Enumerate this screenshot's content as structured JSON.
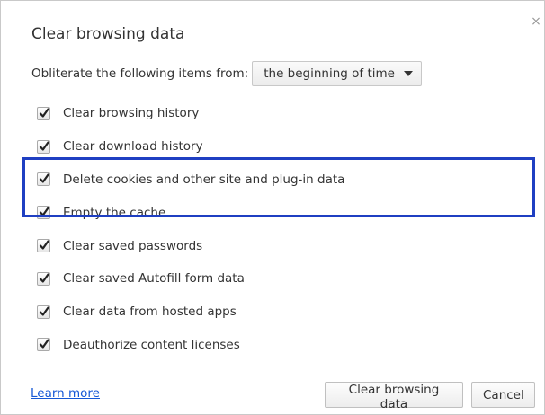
{
  "dialog": {
    "title": "Clear browsing data",
    "close_icon": "×"
  },
  "range": {
    "label": "Obliterate the following items from:",
    "selected": "the beginning of time"
  },
  "options": [
    {
      "label": "Clear browsing history",
      "checked": true
    },
    {
      "label": "Clear download history",
      "checked": true
    },
    {
      "label": "Delete cookies and other site and plug-in data",
      "checked": true
    },
    {
      "label": "Empty the cache",
      "checked": true
    },
    {
      "label": "Clear saved passwords",
      "checked": true
    },
    {
      "label": "Clear saved Autofill form data",
      "checked": true
    },
    {
      "label": "Clear data from hosted apps",
      "checked": true
    },
    {
      "label": "Deauthorize content licenses",
      "checked": true
    }
  ],
  "footer": {
    "learn_more": "Learn more",
    "clear_button": "Clear browsing data",
    "cancel_button": "Cancel"
  },
  "colors": {
    "highlight_border": "#1f3fc2",
    "link": "#1558d6"
  },
  "icons": {
    "close": "close-icon",
    "dropdown": "chevron-down-icon",
    "check": "checkmark-icon"
  }
}
